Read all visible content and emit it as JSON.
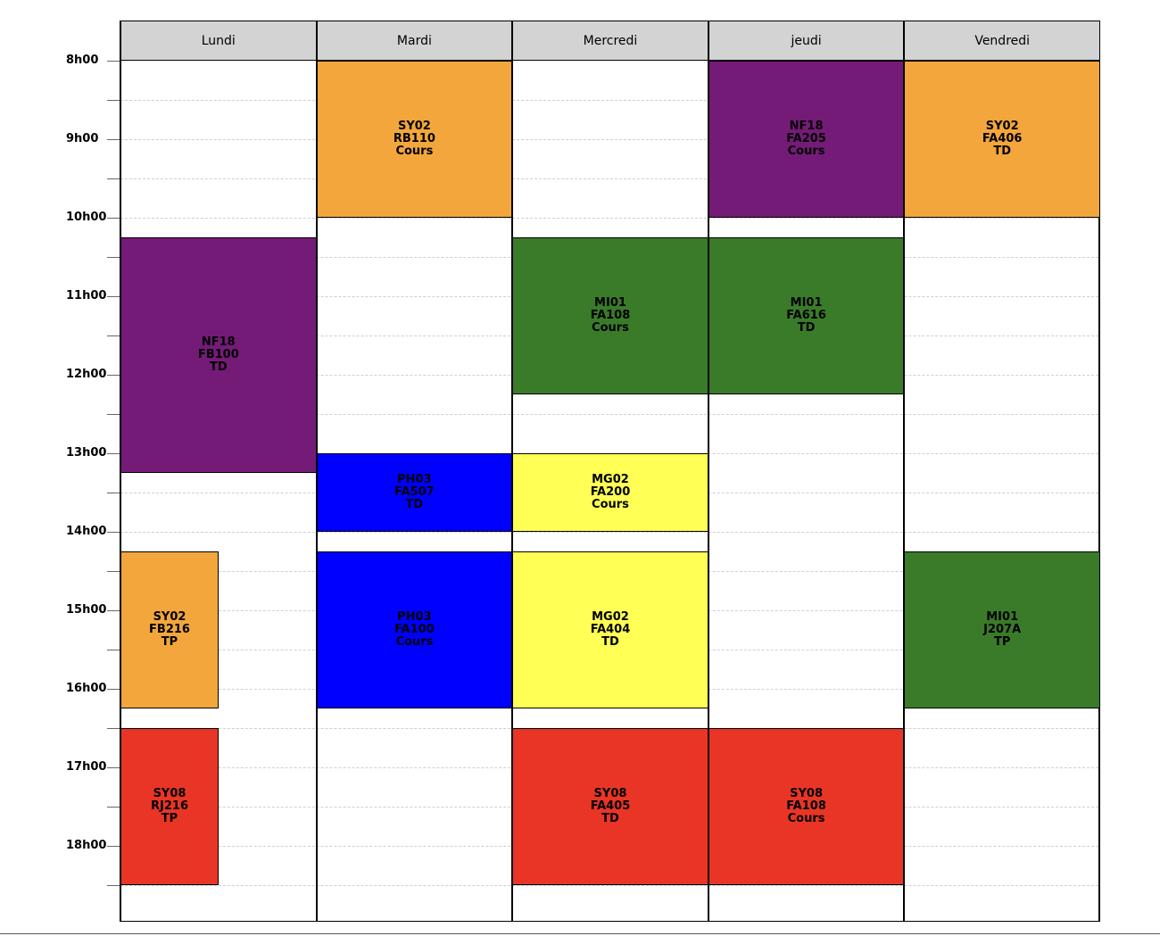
{
  "days": [
    "Lundi",
    "Mardi",
    "Mercredi",
    "jeudi",
    "Vendredi"
  ],
  "hours": [
    "8h00",
    "9h00",
    "10h00",
    "11h00",
    "12h00",
    "13h00",
    "14h00",
    "15h00",
    "16h00",
    "17h00",
    "18h00"
  ],
  "colors": {
    "orange": "#f2a63c",
    "purple": "#741b77",
    "green": "#3a7b2a",
    "blue": "#0000ff",
    "yellow": "#ffff55",
    "red": "#e93526",
    "header": "#d3d3d3"
  },
  "events": [
    {
      "day": 1,
      "start": 8.0,
      "end": 10.0,
      "span": "full",
      "color": "orange",
      "code": "SY02",
      "room": "RB110",
      "type": "Cours"
    },
    {
      "day": 3,
      "start": 8.0,
      "end": 10.0,
      "span": "full",
      "color": "purple",
      "code": "NF18",
      "room": "FA205",
      "type": "Cours"
    },
    {
      "day": 4,
      "start": 8.0,
      "end": 10.0,
      "span": "full",
      "color": "orange",
      "code": "SY02",
      "room": "FA406",
      "type": "TD"
    },
    {
      "day": 0,
      "start": 10.25,
      "end": 13.25,
      "span": "full",
      "color": "purple",
      "code": "NF18",
      "room": "FB100",
      "type": "TD"
    },
    {
      "day": 2,
      "start": 10.25,
      "end": 12.25,
      "span": "full",
      "color": "green",
      "code": "MI01",
      "room": "FA108",
      "type": "Cours"
    },
    {
      "day": 3,
      "start": 10.25,
      "end": 12.25,
      "span": "full",
      "color": "green",
      "code": "MI01",
      "room": "FA616",
      "type": "TD"
    },
    {
      "day": 1,
      "start": 13.0,
      "end": 14.0,
      "span": "full",
      "color": "blue",
      "code": "PH03",
      "room": "FA507",
      "type": "TD"
    },
    {
      "day": 2,
      "start": 13.0,
      "end": 14.0,
      "span": "full",
      "color": "yellow",
      "code": "MG02",
      "room": "FA200",
      "type": "Cours"
    },
    {
      "day": 0,
      "start": 14.25,
      "end": 16.25,
      "span": "half",
      "color": "orange",
      "code": "SY02",
      "room": "FB216",
      "type": "TP"
    },
    {
      "day": 1,
      "start": 14.25,
      "end": 16.25,
      "span": "full",
      "color": "blue",
      "code": "PH03",
      "room": "FA100",
      "type": "Cours"
    },
    {
      "day": 2,
      "start": 14.25,
      "end": 16.25,
      "span": "full",
      "color": "yellow",
      "code": "MG02",
      "room": "FA404",
      "type": "TD"
    },
    {
      "day": 4,
      "start": 14.25,
      "end": 16.25,
      "span": "full",
      "color": "green",
      "code": "MI01",
      "room": "J207A",
      "type": "TP"
    },
    {
      "day": 0,
      "start": 16.5,
      "end": 18.5,
      "span": "half",
      "color": "red",
      "code": "SY08",
      "room": "RJ216",
      "type": "TP"
    },
    {
      "day": 2,
      "start": 16.5,
      "end": 18.5,
      "span": "full",
      "color": "red",
      "code": "SY08",
      "room": "FA405",
      "type": "TD"
    },
    {
      "day": 3,
      "start": 16.5,
      "end": 18.5,
      "span": "full",
      "color": "red",
      "code": "SY08",
      "room": "FA108",
      "type": "Cours"
    }
  ]
}
